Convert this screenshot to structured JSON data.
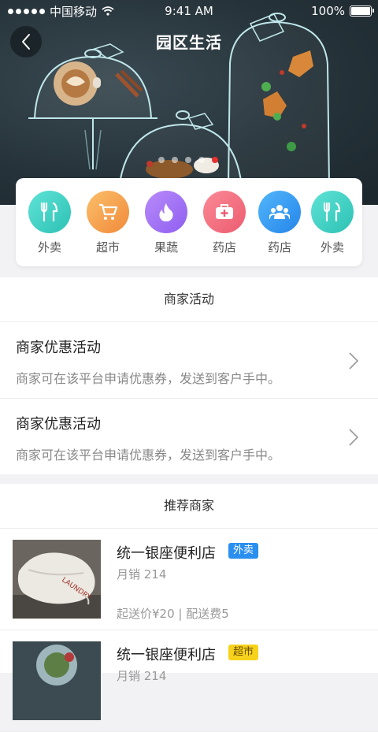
{
  "status_bar": {
    "carrier": "中国移动",
    "time": "9:41 AM",
    "battery": "100%"
  },
  "header": {
    "title": "园区生活",
    "back_icon": "chevron-left-icon"
  },
  "categories": [
    {
      "label": "外卖",
      "icon": "fork-knife-icon",
      "color": "#39d0c4"
    },
    {
      "label": "超市",
      "icon": "cart-icon",
      "color": "#f5a04a"
    },
    {
      "label": "果蔬",
      "icon": "flame-icon",
      "color": "#a578f0"
    },
    {
      "label": "药店",
      "icon": "medkit-icon",
      "color": "#f06d7d"
    },
    {
      "label": "药店",
      "icon": "group-icon",
      "color": "#3498f0"
    },
    {
      "label": "外卖",
      "icon": "fork-knife-icon",
      "color": "#39d0c4"
    }
  ],
  "activities": {
    "title": "商家活动",
    "items": [
      {
        "title": "商家优惠活动",
        "desc": "商家可在该平台申请优惠券，发送到客户手中。"
      },
      {
        "title": "商家优惠活动",
        "desc": "商家可在该平台申请优惠券，发送到客户手中。"
      }
    ]
  },
  "merchants": {
    "title": "推荐商家",
    "items": [
      {
        "name": "统一银座便利店",
        "tag": "外卖",
        "tag_color": "#2b8ff0",
        "tag_text_color": "#ffffff",
        "sales": "月销 214",
        "delivery": "起送价¥20 | 配送费5"
      },
      {
        "name": "统一银座便利店",
        "tag": "超市",
        "tag_color": "#f7d21c",
        "tag_text_color": "#6b4e00",
        "sales": "月销 214",
        "delivery": ""
      }
    ]
  }
}
